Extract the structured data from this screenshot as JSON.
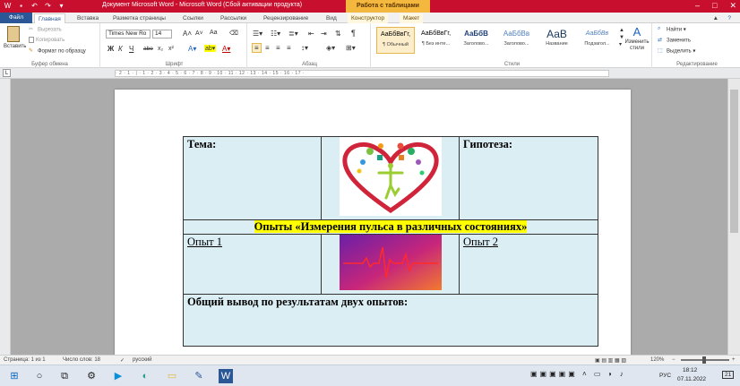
{
  "window": {
    "title": "Документ Microsoft Word  -  Microsoft Word (Сбой активации продукта)",
    "context_title": "Работа с таблицами"
  },
  "tabs": [
    "Файл",
    "Главная",
    "Вставка",
    "Разметка страницы",
    "Ссылки",
    "Рассылки",
    "Рецензирование",
    "Вид",
    "Конструктор",
    "Макет"
  ],
  "ribbon": {
    "clipboard": {
      "paste": "Вставить",
      "cut": "Вырезать",
      "copy": "Копировать",
      "format_painter": "Формат по образцу",
      "label": "Буфер обмена"
    },
    "font": {
      "name": "Times New Ro",
      "size": "14",
      "label": "Шрифт",
      "grow": "A",
      "shrink": "A",
      "change_case": "Aa",
      "bold": "Ж",
      "italic": "К",
      "underline": "Ч",
      "strike": "abe",
      "subscript": "x₂",
      "superscript": "x²"
    },
    "paragraph": {
      "label": "Абзац",
      "pilcrow": "¶"
    },
    "styles": {
      "label": "Стили",
      "items": [
        {
          "sample": "АаБбВвГг,",
          "name": "¶ Обычный"
        },
        {
          "sample": "АаБбВвГг,",
          "name": "¶ Без инте..."
        },
        {
          "sample": "АаБбВ",
          "name": "Заголово..."
        },
        {
          "sample": "АаБбВв",
          "name": "Заголово..."
        },
        {
          "sample": "АаВ",
          "name": "Название"
        },
        {
          "sample": "АаБбВв",
          "name": "Подзагол..."
        }
      ],
      "change_styles": "Изменить стили"
    },
    "editing": {
      "label": "Редактирование",
      "find": "Найти",
      "replace": "Заменить",
      "select": "Выделить"
    }
  },
  "ruler_marks": "· 2 · 1 · | · 1 · 2 · 3 · 4 · 5 · 6 · 7 · 8 · 9 · 10 · 11 · 12 · 13 · 14 · 15 · 16 · 17 ·",
  "document": {
    "topic_label": "Тема:",
    "hypothesis_label": "Гипотеза:",
    "banner": "Опыты «Измерения пульса в различных состояниях»",
    "experiment1": "Опыт 1",
    "experiment2": "Опыт 2",
    "conclusion": "Общий вывод по результатам  двух опытов:"
  },
  "status": {
    "page": "Страница: 1 из 1",
    "words": "Число слов: 18",
    "lang": "русский",
    "zoom": "120%"
  },
  "taskbar": {
    "lang": "РУС",
    "time": "18:12",
    "date": "07.11.2022",
    "notifications": "21"
  },
  "colors": {
    "titlebar": "#c8102e",
    "context_tab": "#f4b83f",
    "table_cell": "#dbeef4",
    "highlight": "#ffff00"
  }
}
